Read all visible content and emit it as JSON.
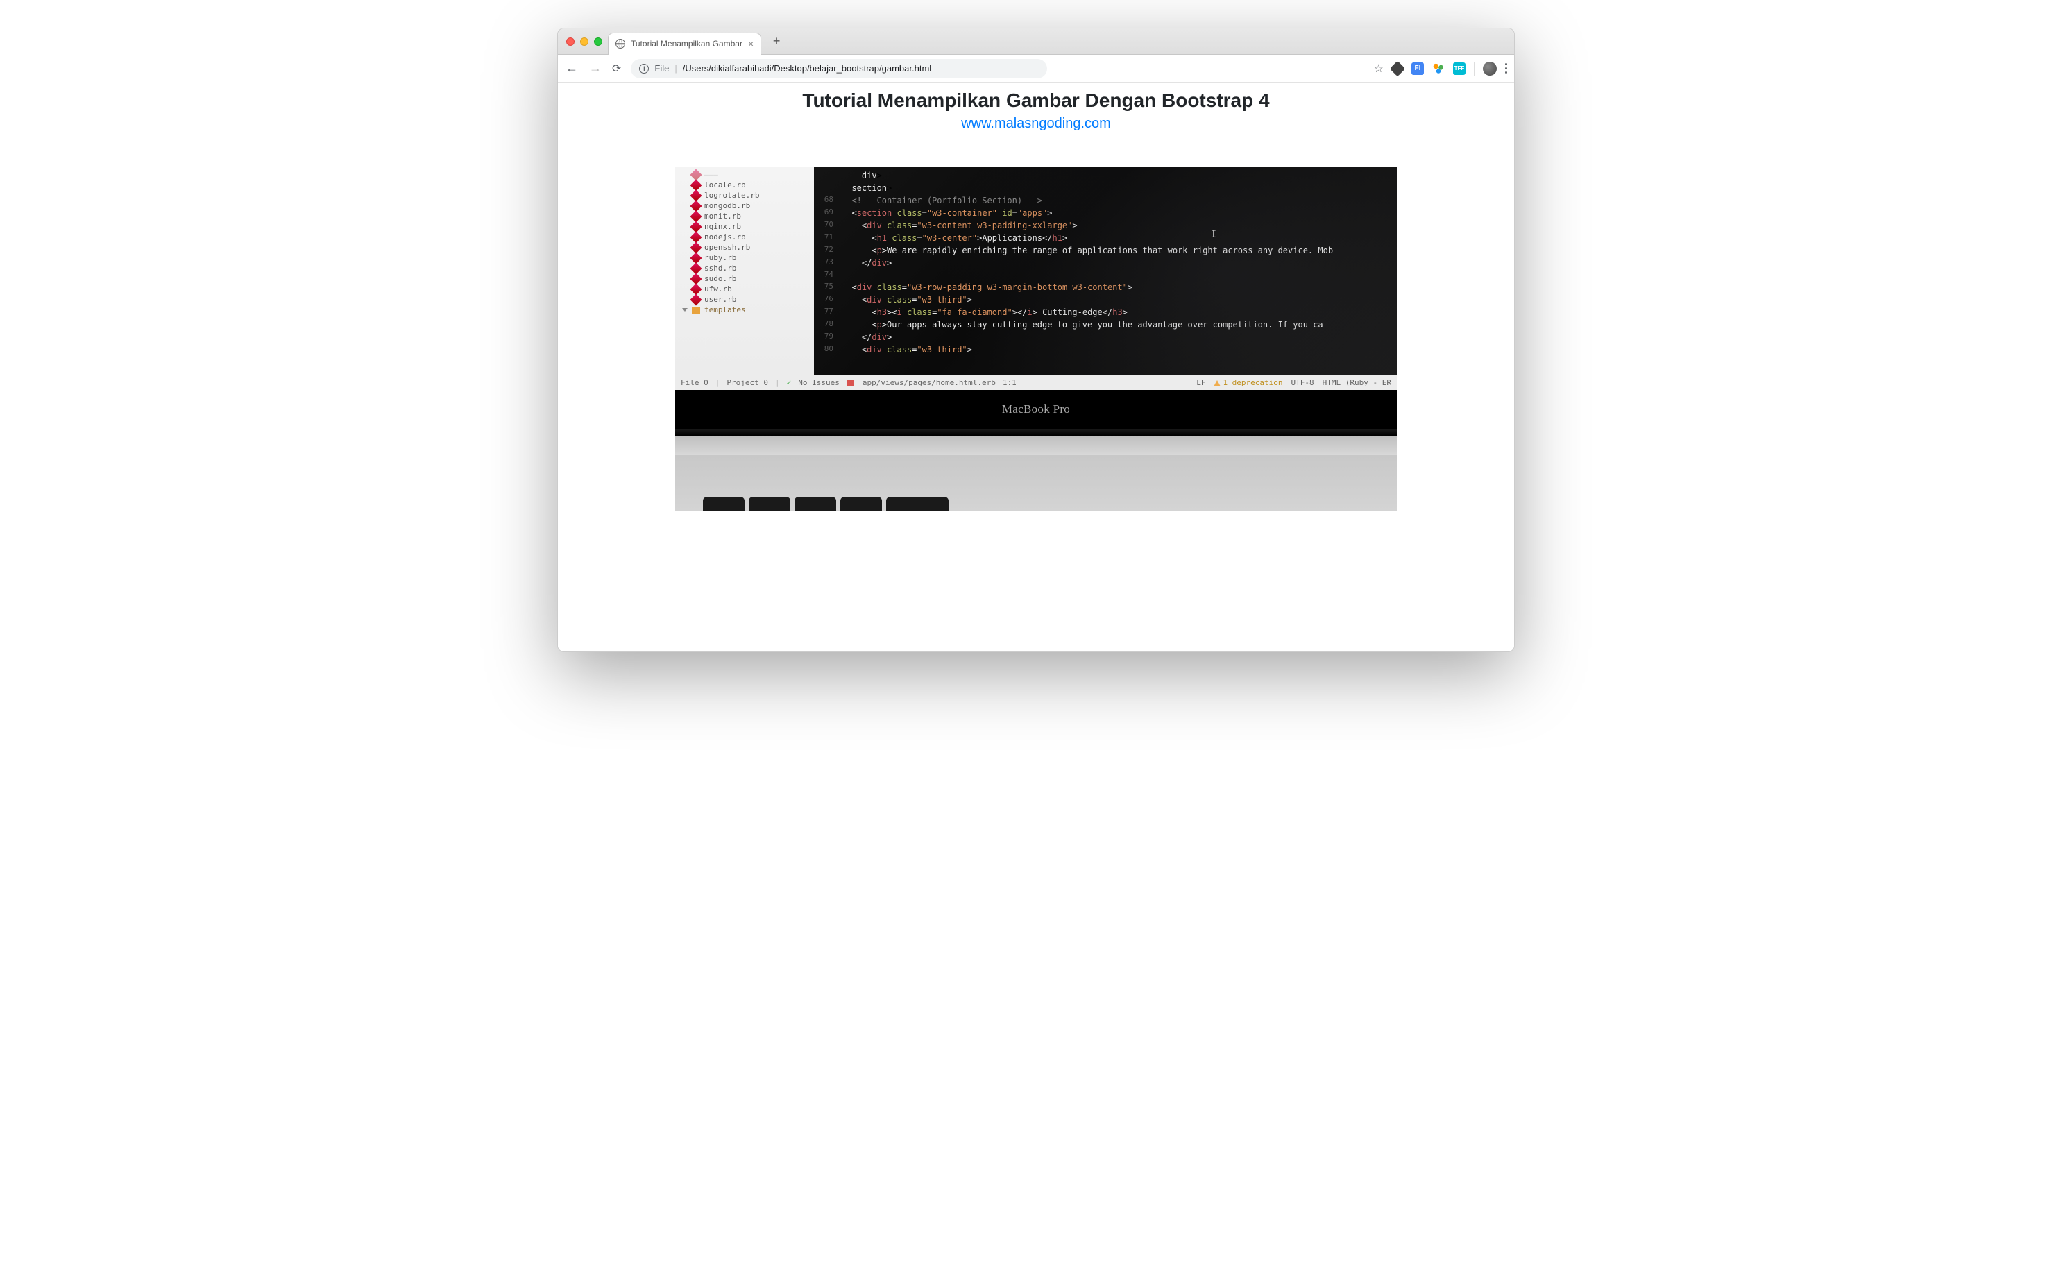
{
  "browser": {
    "tab_title": "Tutorial Menampilkan Gambar",
    "url_scheme": "File",
    "url_path": "/Users/dikialfarabihadi/Desktop/belajar_bootstrap/gambar.html",
    "ext_fl": "Fl",
    "ext_tff": "TFF"
  },
  "page": {
    "heading": "Tutorial Menampilkan Gambar Dengan Bootstrap 4",
    "link": "www.malasngoding.com"
  },
  "editor": {
    "sidebar_files": [
      "locale.rb",
      "logrotate.rb",
      "mongodb.rb",
      "monit.rb",
      "nginx.rb",
      "nodejs.rb",
      "openssh.rb",
      "ruby.rb",
      "sshd.rb",
      "sudo.rb",
      "ufw.rb",
      "user.rb"
    ],
    "sidebar_folder": "templates",
    "code_lines": [
      {
        "n": "",
        "html": "    </<span class='c-red'>div</span>>"
      },
      {
        "n": "",
        "html": "  </<span class='c-red'>section</span>>"
      },
      {
        "n": "",
        "html": ""
      },
      {
        "n": "68",
        "html": "  <span class='c-com'>&lt;!-- Container (Portfolio Section) --&gt;</span>"
      },
      {
        "n": "69",
        "html": "  &lt;<span class='c-red'>section</span> <span class='c-attr'>class</span>=<span class='c-str'>\"w3-container\"</span> <span class='c-attr'>id</span>=<span class='c-str'>\"apps\"</span>&gt;"
      },
      {
        "n": "70",
        "html": "    &lt;<span class='c-red'>div</span> <span class='c-attr'>class</span>=<span class='c-str'>\"w3-content w3-padding-xxlarge\"</span>&gt;"
      },
      {
        "n": "71",
        "html": "      &lt;<span class='c-red'>h1</span> <span class='c-attr'>class</span>=<span class='c-str'>\"w3-center\"</span>&gt;<span class='c-txt'>Applications</span>&lt;/<span class='c-red'>h1</span>&gt;"
      },
      {
        "n": "72",
        "html": "      &lt;<span class='c-red'>p</span>&gt;<span class='c-txt'>We are rapidly enriching the range of applications that work right across any device. Mob</span>"
      },
      {
        "n": "73",
        "html": "    &lt;/<span class='c-red'>div</span>&gt;"
      },
      {
        "n": "74",
        "html": ""
      },
      {
        "n": "75",
        "html": "  &lt;<span class='c-red'>div</span> <span class='c-attr'>class</span>=<span class='c-str'>\"w3-row-padding w3-margin-bottom w3-content\"</span>&gt;"
      },
      {
        "n": "76",
        "html": "    &lt;<span class='c-red'>div</span> <span class='c-attr'>class</span>=<span class='c-str'>\"w3-third\"</span>&gt;"
      },
      {
        "n": "77",
        "html": "      &lt;<span class='c-red'>h3</span>&gt;&lt;<span class='c-red'>i</span> <span class='c-attr'>class</span>=<span class='c-str'>\"fa fa-diamond\"</span>&gt;&lt;/<span class='c-red'>i</span>&gt; <span class='c-txt'>Cutting-edge</span>&lt;/<span class='c-red'>h3</span>&gt;"
      },
      {
        "n": "78",
        "html": "      &lt;<span class='c-red'>p</span>&gt;<span class='c-txt'>Our apps always stay cutting-edge to give you the advantage over competition. If you ca</span>"
      },
      {
        "n": "79",
        "html": "    &lt;/<span class='c-red'>div</span>&gt;"
      },
      {
        "n": "80",
        "html": "    &lt;<span class='c-red'>div</span> <span class='c-attr'>class</span>=<span class='c-str'>\"w3-third\"</span>&gt;"
      }
    ],
    "status": {
      "file": "File 0",
      "project": "Project 0",
      "issues": "No Issues",
      "path": "app/views/pages/home.html.erb",
      "pos": "1:1",
      "enc_line": "LF",
      "deprecation": "1 deprecation",
      "encoding": "UTF-8",
      "lang": "HTML (Ruby - ER"
    }
  },
  "laptop": {
    "brand": "MacBook Pro"
  }
}
